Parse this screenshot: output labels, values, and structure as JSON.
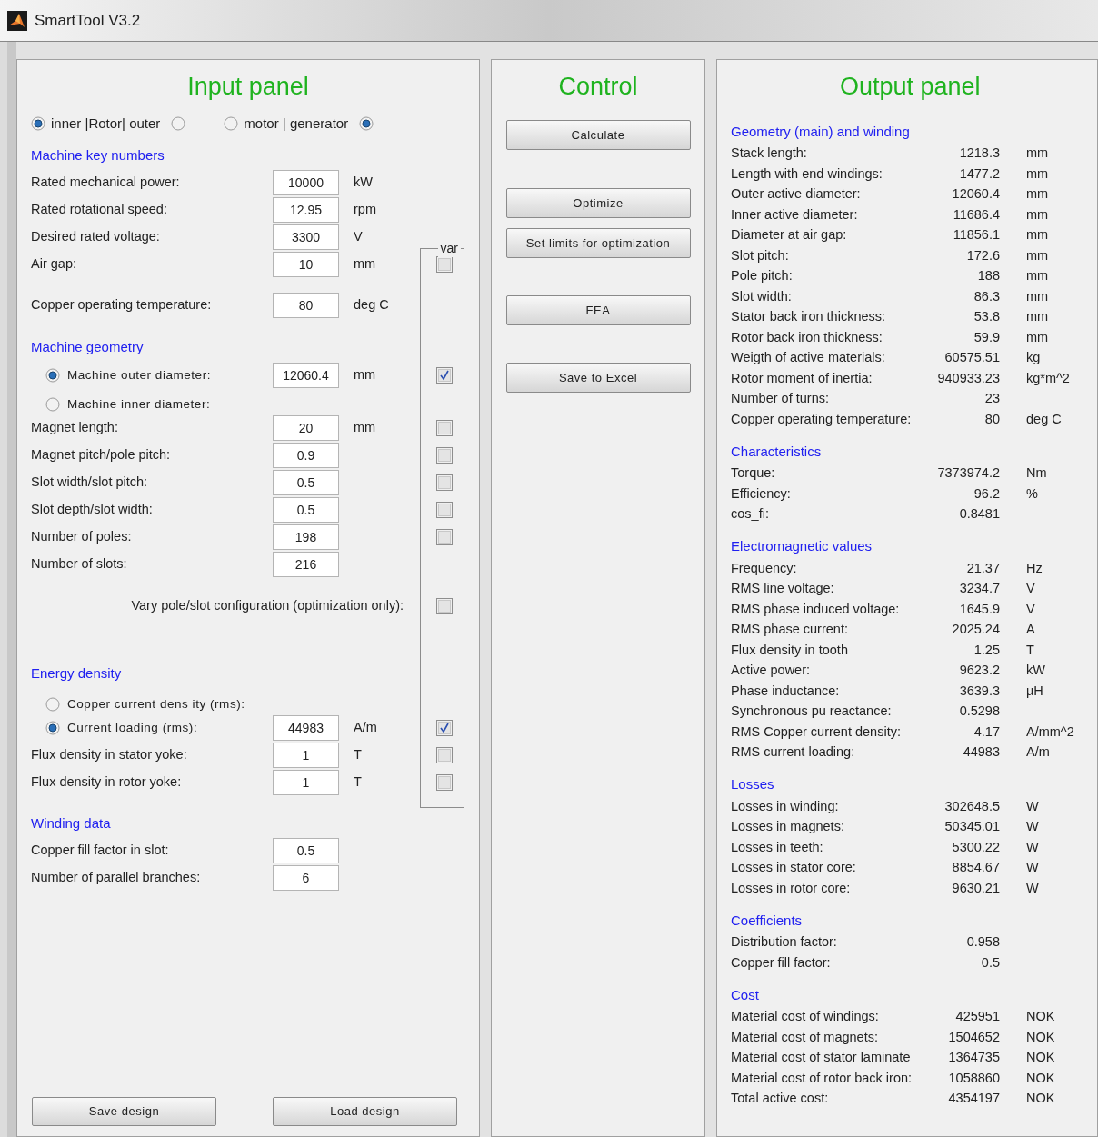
{
  "window": {
    "title": "SmartTool V3.2"
  },
  "input_panel": {
    "title": "Input panel",
    "toggles": [
      {
        "label": "inner |Rotor| outer",
        "options": [
          {
            "selected": true
          },
          {
            "selected": false
          }
        ]
      },
      {
        "label": "motor | generator",
        "options": [
          {
            "selected": false
          },
          {
            "selected": true
          }
        ]
      }
    ],
    "var_label": "var",
    "sections": [
      {
        "heading": "Machine key numbers",
        "items": [
          {
            "kind": "field",
            "label": "Rated mechanical power:",
            "value": "10000",
            "unit": "kW"
          },
          {
            "kind": "field",
            "label": "Rated rotational speed:",
            "value": "12.95",
            "unit": "rpm"
          },
          {
            "kind": "field",
            "label": "Desired rated voltage:",
            "value": "3300",
            "unit": "V"
          },
          {
            "kind": "field",
            "label": "Air gap:",
            "value": "10",
            "unit": "mm",
            "var": false
          },
          {
            "kind": "field",
            "label": "Copper operating temperature:",
            "value": "80",
            "unit": "deg C"
          }
        ]
      },
      {
        "heading": "Machine geometry",
        "items": [
          {
            "kind": "radio_field",
            "label": "Machine outer diameter:",
            "selected": true,
            "value": "12060.4",
            "unit": "mm",
            "var": true
          },
          {
            "kind": "radio",
            "label": "Machine inner diameter:",
            "selected": false
          },
          {
            "kind": "field",
            "label": "Magnet length:",
            "value": "20",
            "unit": "mm",
            "var": false
          },
          {
            "kind": "field",
            "label": "Magnet pitch/pole pitch:",
            "value": "0.9",
            "var": false
          },
          {
            "kind": "field",
            "label": "Slot width/slot pitch:",
            "value": "0.5",
            "var": false
          },
          {
            "kind": "field",
            "label": "Slot depth/slot width:",
            "value": "0.5",
            "var": false
          },
          {
            "kind": "field",
            "label": "Number of poles:",
            "value": "198",
            "var": false
          },
          {
            "kind": "field",
            "label": "Number of slots:",
            "value": "216"
          },
          {
            "kind": "checkbox",
            "label": "Vary pole/slot configuration (optimization only):",
            "var": false
          }
        ]
      },
      {
        "heading": "Energy density",
        "items": [
          {
            "kind": "radio",
            "label": "Copper current dens ity (rms):",
            "selected": false
          },
          {
            "kind": "radio_field",
            "label": "Current loading (rms):",
            "selected": true,
            "value": "44983",
            "unit": "A/m",
            "var": true
          },
          {
            "kind": "field",
            "label": "Flux density in stator yoke:",
            "value": "1",
            "unit": "T",
            "var": false
          },
          {
            "kind": "field",
            "label": "Flux density in rotor yoke:",
            "value": "1",
            "unit": "T",
            "var": false
          }
        ]
      },
      {
        "heading": "Winding data",
        "items": [
          {
            "kind": "field",
            "label": "Copper fill factor in slot:",
            "value": "0.5"
          },
          {
            "kind": "field",
            "label": "Number of parallel branches:",
            "value": "6"
          }
        ]
      }
    ],
    "buttons": [
      "Save design",
      "Load design"
    ]
  },
  "control_panel": {
    "title": "Control",
    "buttons": [
      "Calculate",
      "Optimize",
      "Set limits for optimization",
      "FEA",
      "Save to Excel"
    ]
  },
  "output_panel": {
    "title": "Output panel",
    "sections": [
      {
        "heading": "Geometry (main) and winding",
        "rows": [
          [
            "Stack length:",
            "1218.3",
            "mm"
          ],
          [
            "Length with end windings:",
            "1477.2",
            "mm"
          ],
          [
            "Outer active diameter:",
            "12060.4",
            "mm"
          ],
          [
            "Inner active diameter:",
            "11686.4",
            "mm"
          ],
          [
            "Diameter at air gap:",
            "11856.1",
            "mm"
          ],
          [
            "Slot pitch:",
            "172.6",
            "mm"
          ],
          [
            "Pole pitch:",
            "188",
            "mm"
          ],
          [
            "Slot width:",
            "86.3",
            "mm"
          ],
          [
            "Stator back iron thickness:",
            "53.8",
            "mm"
          ],
          [
            "Rotor back iron thickness:",
            "59.9",
            "mm"
          ],
          [
            "Weigth of active materials:",
            "60575.51",
            "kg"
          ],
          [
            "Rotor moment of inertia:",
            "940933.23",
            "kg*m^2"
          ],
          [
            "Number of turns:",
            "23"
          ],
          [
            "Copper operating temperature:",
            "80",
            "deg C"
          ]
        ]
      },
      {
        "heading": "Characteristics",
        "rows": [
          [
            "Torque:",
            "7373974.2",
            "Nm"
          ],
          [
            "Efficiency:",
            "96.2",
            "%"
          ],
          [
            "cos_fi:",
            "0.8481"
          ]
        ]
      },
      {
        "heading": "Electromagnetic values",
        "rows": [
          [
            "Frequency:",
            "21.37",
            "Hz"
          ],
          [
            "RMS line voltage:",
            "3234.7",
            "V"
          ],
          [
            "RMS phase induced voltage:",
            "1645.9",
            "V"
          ],
          [
            "RMS phase current:",
            "2025.24",
            "A"
          ],
          [
            "Flux density in tooth",
            "1.25",
            "T"
          ],
          [
            "Active power:",
            "9623.2",
            "kW"
          ],
          [
            "Phase inductance:",
            "3639.3",
            "µH"
          ],
          [
            "Synchronous pu reactance:",
            "0.5298"
          ],
          [
            "RMS Copper current density:",
            "4.17",
            "A/mm^2"
          ],
          [
            "RMS current loading:",
            "44983",
            "A/m"
          ]
        ]
      },
      {
        "heading": "Losses",
        "rows": [
          [
            "Losses in winding:",
            "302648.5",
            "W"
          ],
          [
            "Losses in magnets:",
            "50345.01",
            "W"
          ],
          [
            "Losses in teeth:",
            "5300.22",
            "W"
          ],
          [
            "Losses in stator core:",
            "8854.67",
            "W"
          ],
          [
            "Losses in rotor core:",
            "9630.21",
            "W"
          ]
        ]
      },
      {
        "heading": "Coefficients",
        "rows": [
          [
            "Distribution factor:",
            "0.958"
          ],
          [
            "Copper fill factor:",
            "0.5"
          ]
        ]
      },
      {
        "heading": "Cost",
        "rows": [
          [
            "Material cost of windings:",
            "425951",
            "NOK"
          ],
          [
            "Material cost of magnets:",
            "1504652",
            "NOK"
          ],
          [
            "Material cost of stator laminate",
            "1364735",
            "NOK"
          ],
          [
            "Material cost of rotor back iron:",
            "1058860",
            "NOK"
          ],
          [
            "Total active cost:",
            "4354197",
            "NOK"
          ]
        ]
      }
    ]
  }
}
